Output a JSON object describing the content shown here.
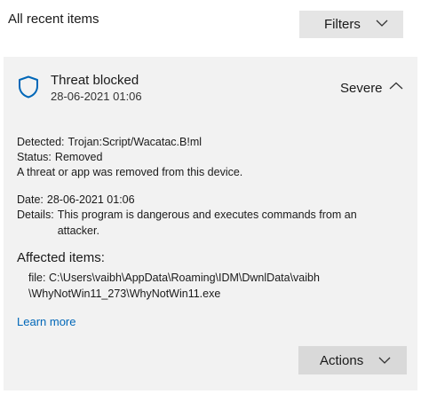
{
  "header": {
    "title": "All recent items",
    "filters_label": "Filters"
  },
  "threat": {
    "icon": "shield-icon",
    "title": "Threat blocked",
    "date": "28-06-2021 01:06",
    "severity": "Severe",
    "detected_label": "Detected:",
    "detected_value": "Trojan:Script/Wacatac.B!ml",
    "status_label": "Status:",
    "status_value": "Removed",
    "status_note": "A threat or app was removed from this device.",
    "date_label": "Date:",
    "date_value": "28-06-2021 01:06",
    "details_label": "Details:",
    "details_value": "This program is dangerous and executes commands from an attacker.",
    "affected_title": "Affected items:",
    "file_label": "file:",
    "file_path_line1": "C:\\Users\\vaibh\\AppData\\Roaming\\IDM\\DwnlData\\vaibh",
    "file_path_line2": "\\WhyNotWin11_273\\WhyNotWin11.exe",
    "learn_more": "Learn more",
    "actions_label": "Actions"
  },
  "colors": {
    "accent": "#0067b8",
    "card_bg": "#f2f2f2",
    "button_bg": "#e5e5e5"
  }
}
